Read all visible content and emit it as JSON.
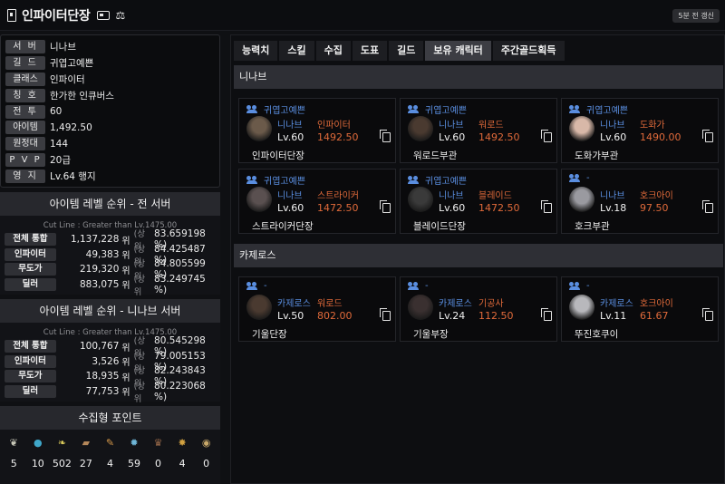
{
  "header": {
    "title": "인파이터단장",
    "refresh_label": "5분 전 갱신"
  },
  "profile": [
    {
      "label": "서 버",
      "value": "니나브"
    },
    {
      "label": "길 드",
      "value": "귀엽고예쁜"
    },
    {
      "label": "클래스",
      "value": "인파이터"
    },
    {
      "label": "칭 호",
      "value": "한가한 인큐버스"
    },
    {
      "label": "전 투",
      "value": "60"
    },
    {
      "label": "아이템",
      "value": "1,492.50"
    },
    {
      "label": "원정대",
      "value": "144"
    },
    {
      "label": "P V P",
      "value": "20급"
    },
    {
      "label": "영 지",
      "value": "Lv.64 행지"
    }
  ],
  "rank_all": {
    "title": "아이템 레벨 순위 - 전 서버",
    "cutline": "Cut Line : Greater than Lv.1475.00",
    "rows": [
      {
        "label": "전체 통합",
        "rank": "1,137,228",
        "unit": "위",
        "sub": "(상위",
        "pct": "83.659198 %)"
      },
      {
        "label": "인파이터",
        "rank": "49,383",
        "unit": "위",
        "sub": "(상위",
        "pct": "84.425487 %)"
      },
      {
        "label": "무도가",
        "rank": "219,320",
        "unit": "위",
        "sub": "(상위",
        "pct": "84.805599 %)"
      },
      {
        "label": "딜러",
        "rank": "883,075",
        "unit": "위",
        "sub": "(상위",
        "pct": "83.249745 %)"
      }
    ]
  },
  "rank_server": {
    "title": "아이템 레벨 순위 - 니나브 서버",
    "cutline": "Cut Line : Greater than Lv.1475.00",
    "rows": [
      {
        "label": "전체 통합",
        "rank": "100,767",
        "unit": "위",
        "sub": "(상위",
        "pct": "80.545298 %)"
      },
      {
        "label": "인파이터",
        "rank": "3,526",
        "unit": "위",
        "sub": "(상위",
        "pct": "79.005153 %)"
      },
      {
        "label": "무도가",
        "rank": "18,935",
        "unit": "위",
        "sub": "(상위",
        "pct": "82.243843 %)"
      },
      {
        "label": "딜러",
        "rank": "77,753",
        "unit": "위",
        "sub": "(상위",
        "pct": "80.223068 %)"
      }
    ]
  },
  "collect": {
    "title": "수집형 포인트",
    "items": [
      {
        "icon": "mokoko-seed-icon",
        "count": "5",
        "color": "#c8c8b8"
      },
      {
        "icon": "island-heart-icon",
        "count": "10",
        "color": "#3fa7c9"
      },
      {
        "icon": "giant-heart-icon",
        "count": "502",
        "color": "#d9c95a"
      },
      {
        "icon": "art-icon",
        "count": "27",
        "color": "#b4875a"
      },
      {
        "icon": "voyage-icon",
        "count": "4",
        "color": "#d89a4a"
      },
      {
        "icon": "star-icon",
        "count": "59",
        "color": "#6fb7d9"
      },
      {
        "icon": "world-tree-leaf-icon",
        "count": "0",
        "color": "#9a6a4a"
      },
      {
        "icon": "ignea-token-icon",
        "count": "4",
        "color": "#d0a040"
      },
      {
        "icon": "orpheus-star-icon",
        "count": "0",
        "color": "#c8a86a"
      }
    ]
  },
  "tabs": [
    {
      "label": "능력치",
      "active": false
    },
    {
      "label": "스킬",
      "active": false
    },
    {
      "label": "수집",
      "active": false
    },
    {
      "label": "도표",
      "active": false
    },
    {
      "label": "길드",
      "active": false
    },
    {
      "label": "보유 캐릭터",
      "active": true
    },
    {
      "label": "주간골드획득",
      "active": false
    }
  ],
  "groups": [
    {
      "server": "니나브",
      "characters": [
        {
          "guild": "귀엽고예쁜",
          "server": "니나브",
          "class": "인파이터",
          "level": "Lv.60",
          "ilvl": "1492.50",
          "name": "인파이터단장",
          "avatar_color": "#6b5a4a"
        },
        {
          "guild": "귀엽고예쁜",
          "server": "니나브",
          "class": "워로드",
          "level": "Lv.60",
          "ilvl": "1492.50",
          "name": "워로드부관",
          "avatar_color": "#4a3a30"
        },
        {
          "guild": "귀엽고예쁜",
          "server": "니나브",
          "class": "도화가",
          "level": "Lv.60",
          "ilvl": "1490.00",
          "name": "도화가부관",
          "avatar_color": "#d8b8a8"
        },
        {
          "guild": "귀엽고예쁜",
          "server": "니나브",
          "class": "스트라이커",
          "level": "Lv.60",
          "ilvl": "1472.50",
          "name": "스트라이커단장",
          "avatar_color": "#5a5050"
        },
        {
          "guild": "귀엽고예쁜",
          "server": "니나브",
          "class": "블레이드",
          "level": "Lv.60",
          "ilvl": "1472.50",
          "name": "블레이드단장",
          "avatar_color": "#3a3a3a"
        },
        {
          "guild": "-",
          "server": "니나브",
          "class": "호크아이",
          "level": "Lv.18",
          "ilvl": "97.50",
          "name": "호크부관",
          "avatar_color": "#9a9aa0"
        }
      ]
    },
    {
      "server": "카제로스",
      "characters": [
        {
          "guild": "-",
          "server": "카제로스",
          "class": "워로드",
          "level": "Lv.50",
          "ilvl": "802.00",
          "name": "기울단장",
          "avatar_color": "#4a3a30"
        },
        {
          "guild": "-",
          "server": "카제로스",
          "class": "기공사",
          "level": "Lv.24",
          "ilvl": "112.50",
          "name": "기울부장",
          "avatar_color": "#3a3030"
        },
        {
          "guild": "-",
          "server": "카제로스",
          "class": "호크아이",
          "level": "Lv.11",
          "ilvl": "61.67",
          "name": "뚜진호쿠이",
          "avatar_color": "#b8b8bc"
        }
      ]
    }
  ]
}
